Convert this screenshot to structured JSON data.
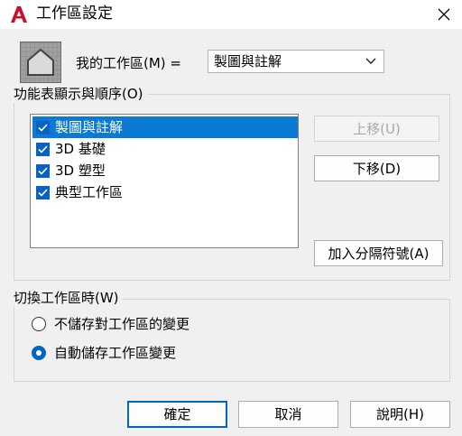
{
  "window": {
    "title": "工作區設定",
    "app_icon": "autocad-a-icon",
    "close_icon": "close-icon"
  },
  "workspace": {
    "icon": "house-icon",
    "label": "我的工作區(M) =",
    "selected": "製圖與註解"
  },
  "ribbon": {
    "legend": "功能表顯示與順序(O)",
    "items": [
      {
        "label": "製圖與註解",
        "checked": true,
        "selected": true
      },
      {
        "label": "3D 基礎",
        "checked": true,
        "selected": false
      },
      {
        "label": "3D 塑型",
        "checked": true,
        "selected": false
      },
      {
        "label": "典型工作區",
        "checked": true,
        "selected": false
      }
    ],
    "move_up": "上移(U)",
    "move_down": "下移(D)",
    "add_separator": "加入分隔符號(A)"
  },
  "switch": {
    "legend": "切換工作區時(W)",
    "options": [
      {
        "label": "不儲存對工作區的變更",
        "selected": false
      },
      {
        "label": "自動儲存工作區變更",
        "selected": true
      }
    ]
  },
  "footer": {
    "ok": "確定",
    "cancel": "取消",
    "help": "說明(H)"
  },
  "colors": {
    "accent": "#0a7ad4",
    "checkbox": "#0a63c2",
    "autocad_red": "#c8102e"
  }
}
